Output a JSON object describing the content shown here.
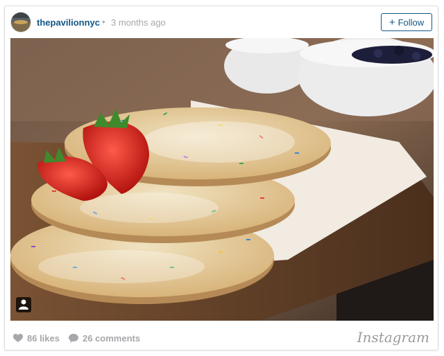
{
  "post": {
    "username": "thepavilionnyc",
    "separator": "•",
    "timestamp": "3 months ago",
    "follow_label": "Follow",
    "follow_prefix": "+"
  },
  "photo": {
    "alt": "Stack of rainbow sprinkle pancakes with powdered sugar and strawberries on a wooden board",
    "icons": [
      "user-tag-icon"
    ]
  },
  "footer": {
    "likes": "86 likes",
    "comments": "26 comments",
    "brand": "Instagram"
  },
  "colors": {
    "link": "#125688",
    "muted": "#a5a7aa",
    "border": "#dbdbdb"
  }
}
